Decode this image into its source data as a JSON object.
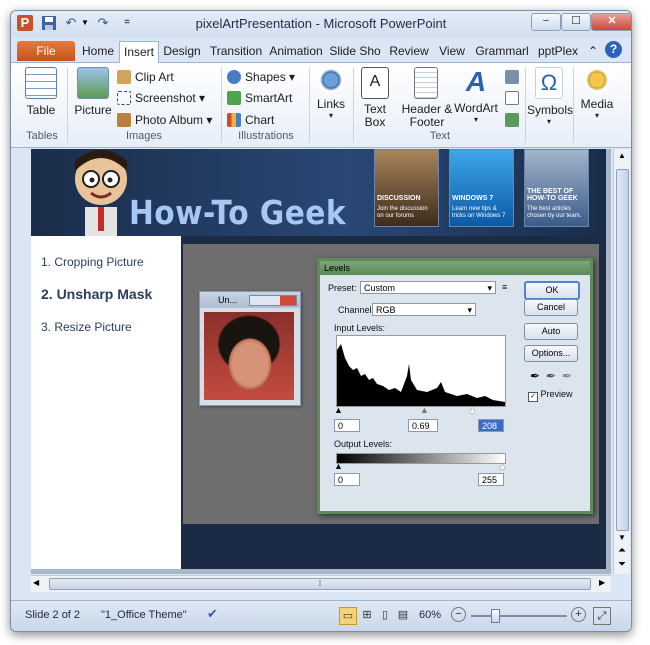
{
  "window": {
    "title": "pixelArtPresentation - Microsoft PowerPoint"
  },
  "qat": {
    "app_icon_letter": "P",
    "customize_glyph": "="
  },
  "window_controls": {
    "minimize": "−",
    "maximize": "☐",
    "close": "✕"
  },
  "tabs": [
    {
      "label": "File"
    },
    {
      "label": "Home"
    },
    {
      "label": "Insert"
    },
    {
      "label": "Design"
    },
    {
      "label": "Transition"
    },
    {
      "label": "Animation"
    },
    {
      "label": "Slide Sho"
    },
    {
      "label": "Review"
    },
    {
      "label": "View"
    },
    {
      "label": "Grammarl"
    },
    {
      "label": "pptPlex"
    }
  ],
  "ribbon_right": {
    "collapse_glyph": "⌃",
    "help_glyph": "?"
  },
  "ribbon": {
    "tables": {
      "table_label": "Table",
      "group_label": "Tables"
    },
    "images": {
      "picture_label": "Picture",
      "clip_art": "Clip Art",
      "screenshot": "Screenshot",
      "photo_album": "Photo Album",
      "group_label": "Images"
    },
    "illustrations": {
      "shapes": "Shapes",
      "smartart": "SmartArt",
      "chart": "Chart",
      "group_label": "Illustrations"
    },
    "links": {
      "label": "Links"
    },
    "text": {
      "text_box": "Text Box",
      "header_footer": "Header & Footer",
      "wordart": "WordArt",
      "group_label": "Text"
    },
    "symbols": {
      "label": "Symbols"
    },
    "media": {
      "label": "Media"
    }
  },
  "slide": {
    "logo_text": "How-To Geek",
    "tiles": [
      {
        "title": "DISCUSSION",
        "subtitle": "Join the discussion on our forums"
      },
      {
        "title": "WINDOWS 7",
        "subtitle": "Learn new tips & tricks on Windows 7"
      },
      {
        "title": "THE BEST OF HOW-TO GEEK",
        "subtitle": "The best articles chosen by our team."
      }
    ],
    "list": [
      {
        "text": "1. Cropping Picture"
      },
      {
        "text": "2. Unsharp Mask"
      },
      {
        "text": "3. Resize Picture"
      }
    ],
    "mini_window": {
      "title": "Un..."
    },
    "levels": {
      "title": "Levels",
      "preset_label": "Preset:",
      "preset_value": "Custom",
      "channel_label": "Channel:",
      "channel_value": "RGB",
      "input_levels_label": "Input Levels:",
      "input_values": [
        "0",
        "0.69",
        "208"
      ],
      "output_levels_label": "Output Levels:",
      "output_values": [
        "0",
        "255"
      ],
      "buttons": {
        "ok": "OK",
        "cancel": "Cancel",
        "auto": "Auto",
        "options": "Options..."
      },
      "preview_label": "Preview",
      "preview_checked": true
    }
  },
  "scrollbar": {
    "up": "▲",
    "down": "▼",
    "prev_slide": "⏶",
    "next_slide": "⏷",
    "left": "◀",
    "right": "▶",
    "grip": "⁞"
  },
  "status": {
    "slide_indicator": "Slide 2 of 2",
    "theme": "\"1_Office Theme\"",
    "zoom": "60%",
    "zoom_out": "−",
    "zoom_in": "+"
  }
}
